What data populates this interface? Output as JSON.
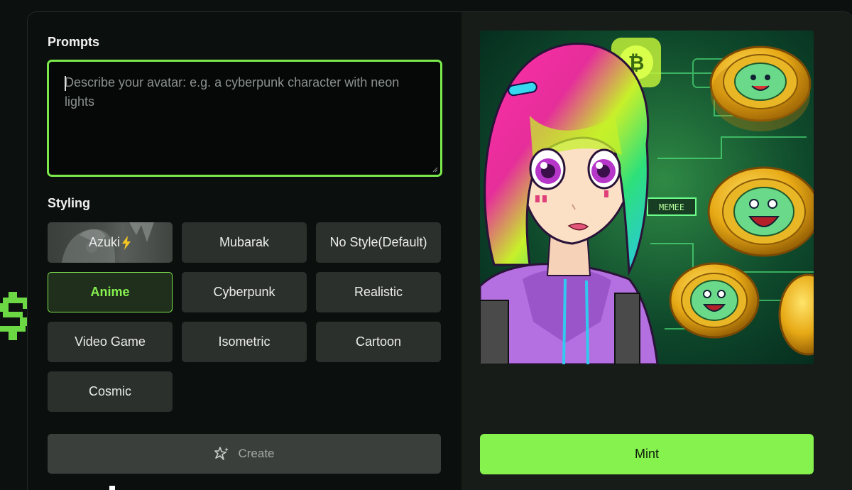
{
  "prompts": {
    "title": "Prompts",
    "placeholder": "Describe your avatar: e.g. a cyberpunk character with neon lights"
  },
  "styling": {
    "title": "Styling",
    "options": [
      {
        "label": "Azuki",
        "selected": false,
        "icon": "lightning-bolt-icon"
      },
      {
        "label": "Mubarak",
        "selected": false
      },
      {
        "label": "No Style(Default)",
        "selected": false
      },
      {
        "label": "Anime",
        "selected": true
      },
      {
        "label": "Cyberpunk",
        "selected": false
      },
      {
        "label": "Realistic",
        "selected": false
      },
      {
        "label": "Video Game",
        "selected": false
      },
      {
        "label": "Isometric",
        "selected": false
      },
      {
        "label": "Cartoon",
        "selected": false
      },
      {
        "label": "Cosmic",
        "selected": false
      }
    ]
  },
  "actions": {
    "create_label": "Create",
    "create_icon": "sparkle-icon",
    "create_disabled": true,
    "mint_label": "Mint"
  },
  "preview": {
    "badge_text": "MEMEE"
  },
  "colors": {
    "accent": "#86f24d",
    "panel_dark": "#0b0f0d",
    "panel_right": "#171c19",
    "button_bg": "#2b302d"
  }
}
